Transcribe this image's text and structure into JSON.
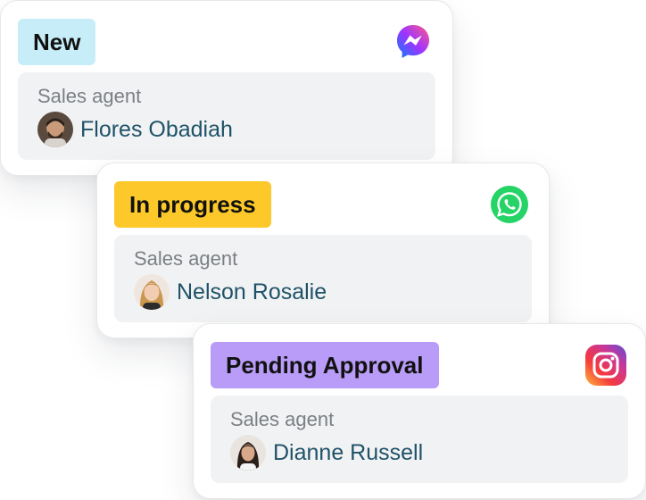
{
  "cards": [
    {
      "status": "New",
      "channel_icon": "messenger-icon",
      "field_label": "Sales agent",
      "agent_name": "Flores Obadiah",
      "status_color": "#c7eef8"
    },
    {
      "status": "In progress",
      "channel_icon": "whatsapp-icon",
      "field_label": "Sales agent",
      "agent_name": "Nelson Rosalie",
      "status_color": "#fcc82a"
    },
    {
      "status": "Pending Approval",
      "channel_icon": "instagram-icon",
      "field_label": "Sales agent",
      "agent_name": "Dianne Russell",
      "status_color": "#b99cf7"
    }
  ],
  "colors": {
    "agent_name": "#1f5268",
    "label": "#7b7f84",
    "info_bg": "#f1f2f3"
  }
}
